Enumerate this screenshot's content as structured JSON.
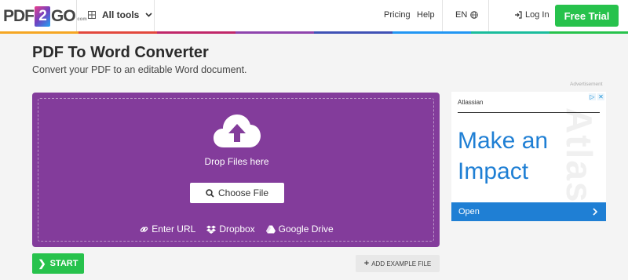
{
  "header": {
    "logo_left": "PDF",
    "logo_two": "2",
    "logo_right": "GO",
    "logo_suffix": ".com",
    "all_tools": "All tools",
    "pricing": "Pricing",
    "help": "Help",
    "language": "EN",
    "login": "Log In",
    "free_trial": "Free Trial",
    "rainbow_colors": [
      "#f5a623",
      "#e2483d",
      "#c0276a",
      "#8e44ad",
      "#3f51b5",
      "#2196f3",
      "#1abc9c",
      "#27c24c"
    ]
  },
  "page": {
    "title": "PDF To Word Converter",
    "subtitle": "Convert your PDF to an editable Word document."
  },
  "upload": {
    "drop_text": "Drop Files here",
    "choose_file": "Choose File",
    "sources": {
      "url": "Enter URL",
      "dropbox": "Dropbox",
      "gdrive": "Google Drive"
    },
    "accent_color": "#833c9b"
  },
  "actions": {
    "start": "START",
    "add_example": "ADD EXAMPLE FILE"
  },
  "ad": {
    "label": "Advertisement",
    "brand": "Atlassian",
    "headline_1": "Make an",
    "headline_2": "Impact",
    "open": "Open",
    "watermark": "Atlassian"
  }
}
